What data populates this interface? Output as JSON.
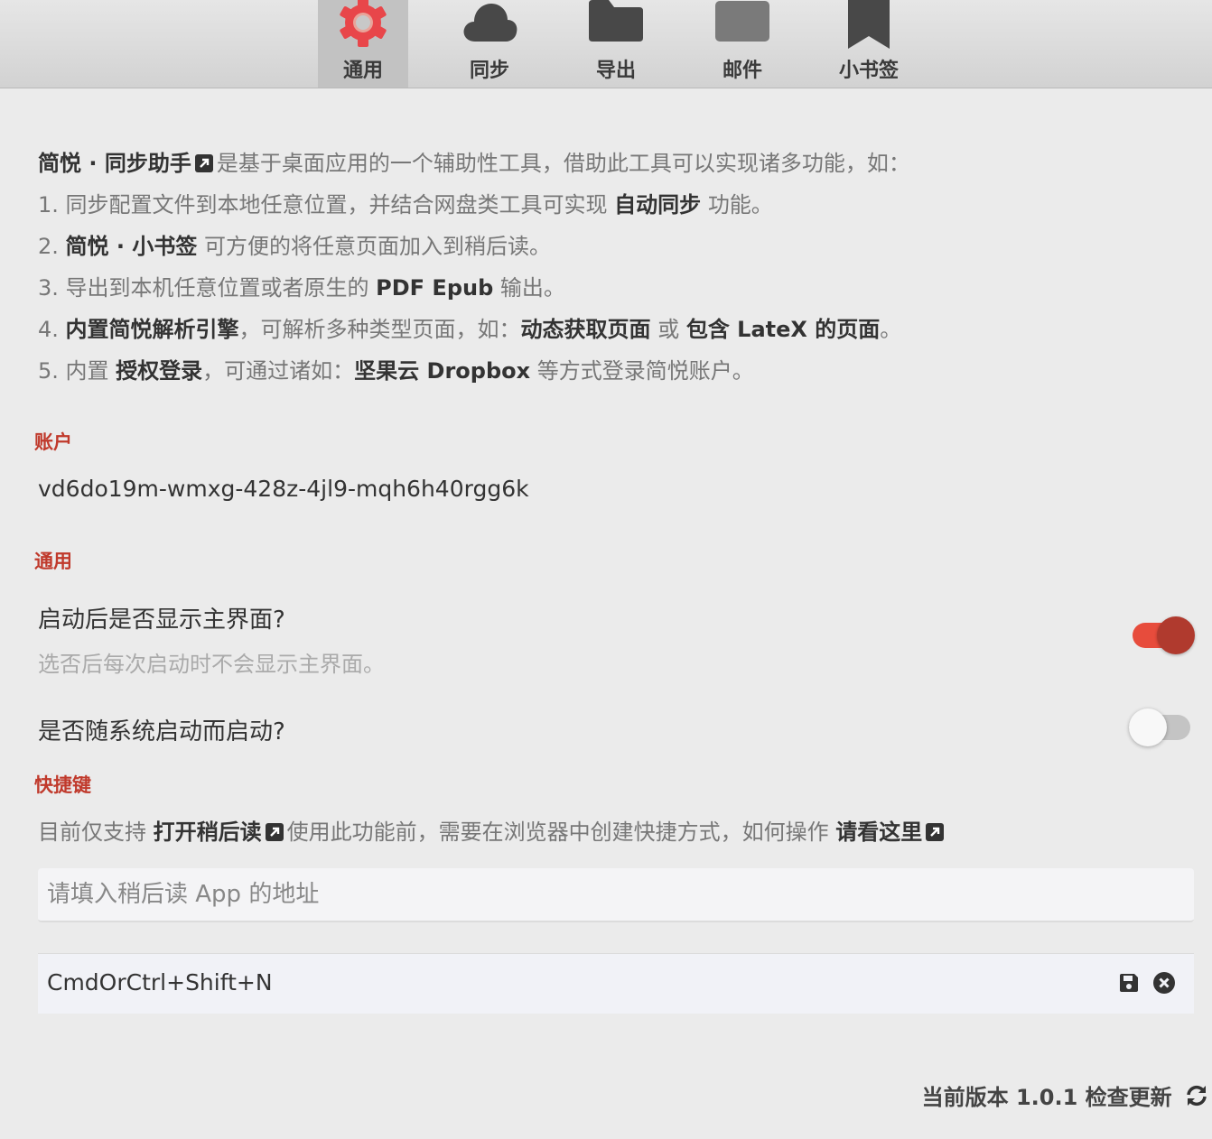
{
  "window": {
    "title": "简悦 · 同步助手"
  },
  "toolbar": {
    "tabs": [
      {
        "label": "通用",
        "icon": "gear-icon",
        "active": true
      },
      {
        "label": "同步",
        "icon": "cloud-icon"
      },
      {
        "label": "导出",
        "icon": "folder-icon"
      },
      {
        "label": "邮件",
        "icon": "mail-icon"
      },
      {
        "label": "小书签",
        "icon": "bookmark-icon"
      }
    ]
  },
  "intro": {
    "line1": {
      "app": "简悦 · 同步助手",
      "text": "是基于桌面应用的一个辅助性工具，借助此工具可以实现诸多功能，如："
    },
    "line2": {
      "prefix": "1. 同步配置文件到本地任意位置，并结合网盘类工具可实现",
      "bold": "自动同步",
      "suffix": "功能。"
    },
    "line3": {
      "prefix": "2.",
      "bold": "简悦 · 小书签",
      "suffix": "可方便的将任意页面加入到稍后读。"
    },
    "line4": {
      "prefix": "3. 导出到本机任意位置或者原生的",
      "bold": "PDF Epub",
      "suffix": "输出。"
    },
    "line5": {
      "prefix": "4.",
      "bold1": "内置简悦解析引擎",
      "mid": "，可解析多种类型页面，如：",
      "bold2": "动态获取页面",
      "or": "或",
      "bold3": "包含 LateX 的页面",
      "suffix": "。"
    },
    "line6": {
      "prefix": "5. 内置",
      "bold1": "授权登录",
      "mid": "，可通过诸如：",
      "bold2": "坚果云 Dropbox",
      "suffix": "等方式登录简悦账户。"
    }
  },
  "account": {
    "section": "账户",
    "id": "vd6do19m-wmxg-428z-4jl9-mqh6h40rgg6k"
  },
  "general": {
    "section": "通用",
    "show_main": {
      "title": "启动后是否显示主界面?",
      "desc": "选否后每次启动时不会显示主界面。",
      "enabled": true
    },
    "auto_start": {
      "title": "是否随系统启动而启动?",
      "enabled": false
    }
  },
  "shortcut": {
    "section": "快捷键",
    "desc_prefix": "目前仅支持",
    "desc_bold": "打开稍后读",
    "desc_mid": "使用此功能前，需要在浏览器中创建快捷方式，如何操作",
    "desc_link": "请看这里",
    "url_placeholder": "请填入稍后读 App 的地址",
    "hotkey": "CmdOrCtrl+Shift+N"
  },
  "footer": {
    "version_label": "当前版本 1.0.1",
    "check_update": "检查更新"
  },
  "colors": {
    "accent": "#c0392b",
    "switch_on": "#e74c3c"
  }
}
